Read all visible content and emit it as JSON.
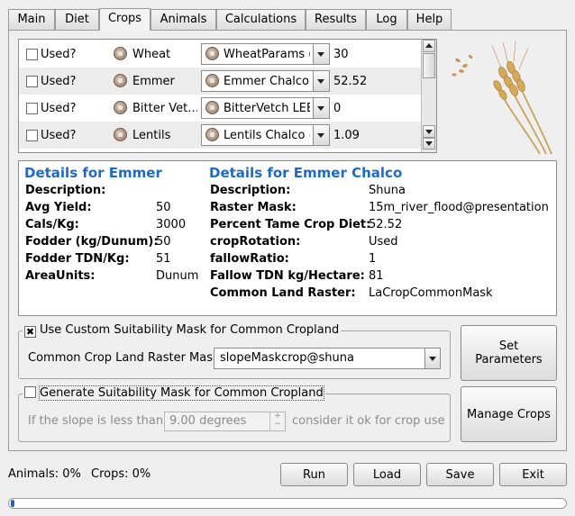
{
  "tabs": [
    {
      "label": "Main"
    },
    {
      "label": "Diet"
    },
    {
      "label": "Crops"
    },
    {
      "label": "Animals"
    },
    {
      "label": "Calculations"
    },
    {
      "label": "Results"
    },
    {
      "label": "Log"
    },
    {
      "label": "Help"
    }
  ],
  "active_tab": "Crops",
  "crop_rows": [
    {
      "used_label": "Used?",
      "checked": false,
      "crop": "Wheat",
      "param": "WheatParams  (",
      "value": "30"
    },
    {
      "used_label": "Used?",
      "checked": false,
      "crop": "Emmer",
      "param": "Emmer Chalco  (",
      "value": "52.52"
    },
    {
      "used_label": "Used?",
      "checked": false,
      "crop": "Bitter Vet…",
      "param": "BitterVetch LEBA",
      "value": "0"
    },
    {
      "used_label": "Used?",
      "checked": false,
      "crop": "Lentils",
      "param": "Lentils Chalco  (",
      "value": "1.09"
    }
  ],
  "details_left": {
    "title": "Details for Emmer",
    "rows": [
      {
        "label": "Description:",
        "value": ""
      },
      {
        "label": "Avg Yield:",
        "value": "50"
      },
      {
        "label": "Cals/Kg:",
        "value": "3000"
      },
      {
        "label": "Fodder (kg/Dunum):",
        "value": "50"
      },
      {
        "label": "Fodder TDN/Kg:",
        "value": "51"
      },
      {
        "label": "AreaUnits:",
        "value": "Dunum"
      }
    ]
  },
  "details_right": {
    "title": "Details for Emmer Chalco",
    "rows": [
      {
        "label": "Description:",
        "value": "Shuna"
      },
      {
        "label": "Raster Mask:",
        "value": "15m_river_flood@presentation"
      },
      {
        "label": "Percent Tame Crop Diet:",
        "value": "52.52"
      },
      {
        "label": "cropRotation:",
        "value": "Used"
      },
      {
        "label": "fallowRatio:",
        "value": "1"
      },
      {
        "label": "Fallow TDN kg/Hectare:",
        "value": "81"
      },
      {
        "label": "Common Land Raster:",
        "value": "LaCropCommonMask"
      }
    ]
  },
  "custom_mask": {
    "title": "Use Custom Suitability Mask for Common Cropland",
    "checked": true,
    "field_label": "Common Crop Land Raster Mask",
    "selected": "slopeMaskcrop@shuna"
  },
  "generate_mask": {
    "title": "Generate Suitability Mask for Common Cropland",
    "checked": false,
    "prefix": "If the slope is less than",
    "slope_value": "9.00 degrees",
    "suffix": "consider it ok for crop use"
  },
  "buttons": {
    "set_parameters": "Set Parameters",
    "manage_crops": "Manage Crops",
    "run": "Run",
    "load": "Load",
    "save": "Save",
    "exit": "Exit"
  },
  "status": {
    "animals_label": "Animals:",
    "animals_value": "0%",
    "crops_label": "Crops:",
    "crops_value": "0%"
  },
  "progress_fraction": 0,
  "colors": {
    "title_blue": "#1f6ac6"
  }
}
